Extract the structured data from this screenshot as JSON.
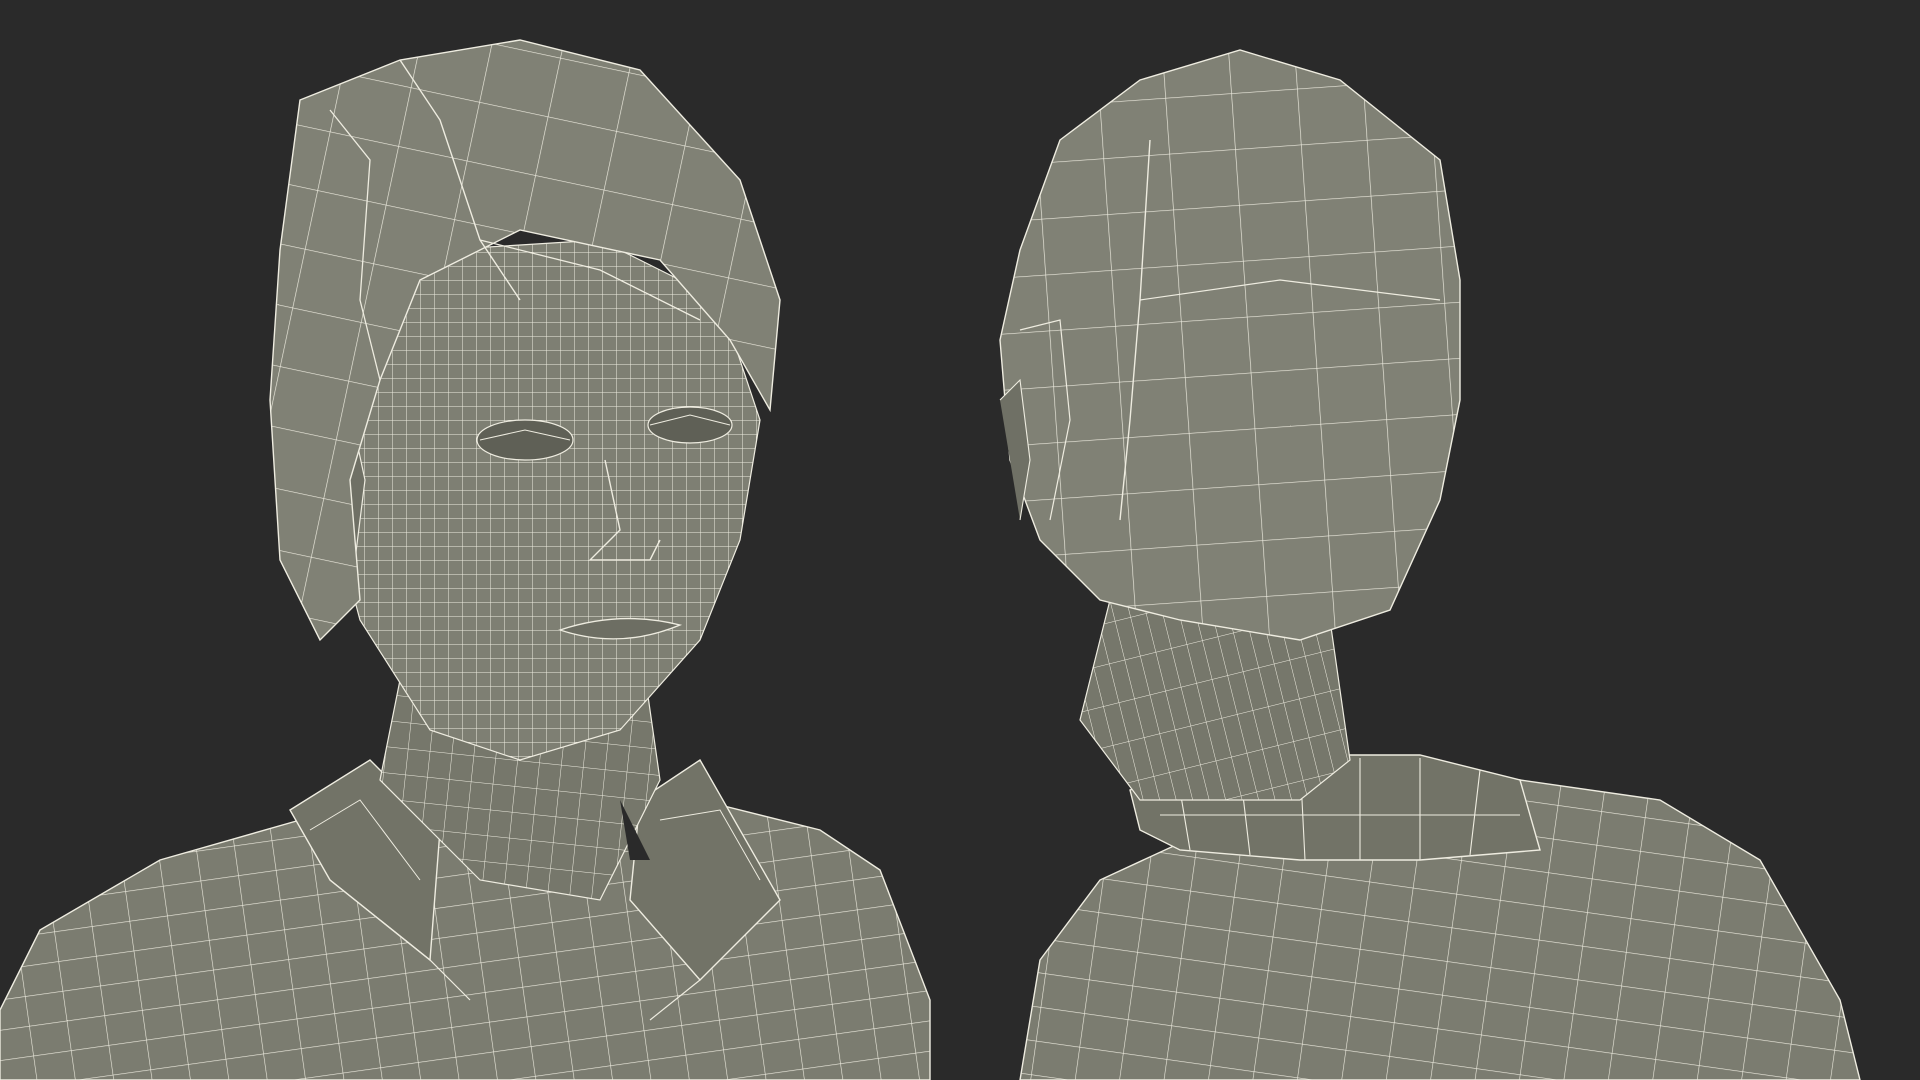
{
  "scene": {
    "background": "#2a2a2a",
    "surface_color": "#7b7c70",
    "surface_shadow": "#5f6056",
    "wire_color": "#eeece0"
  },
  "views": [
    {
      "id": "front",
      "subject": "wireframe-bust-front"
    },
    {
      "id": "back",
      "subject": "wireframe-bust-back"
    }
  ]
}
